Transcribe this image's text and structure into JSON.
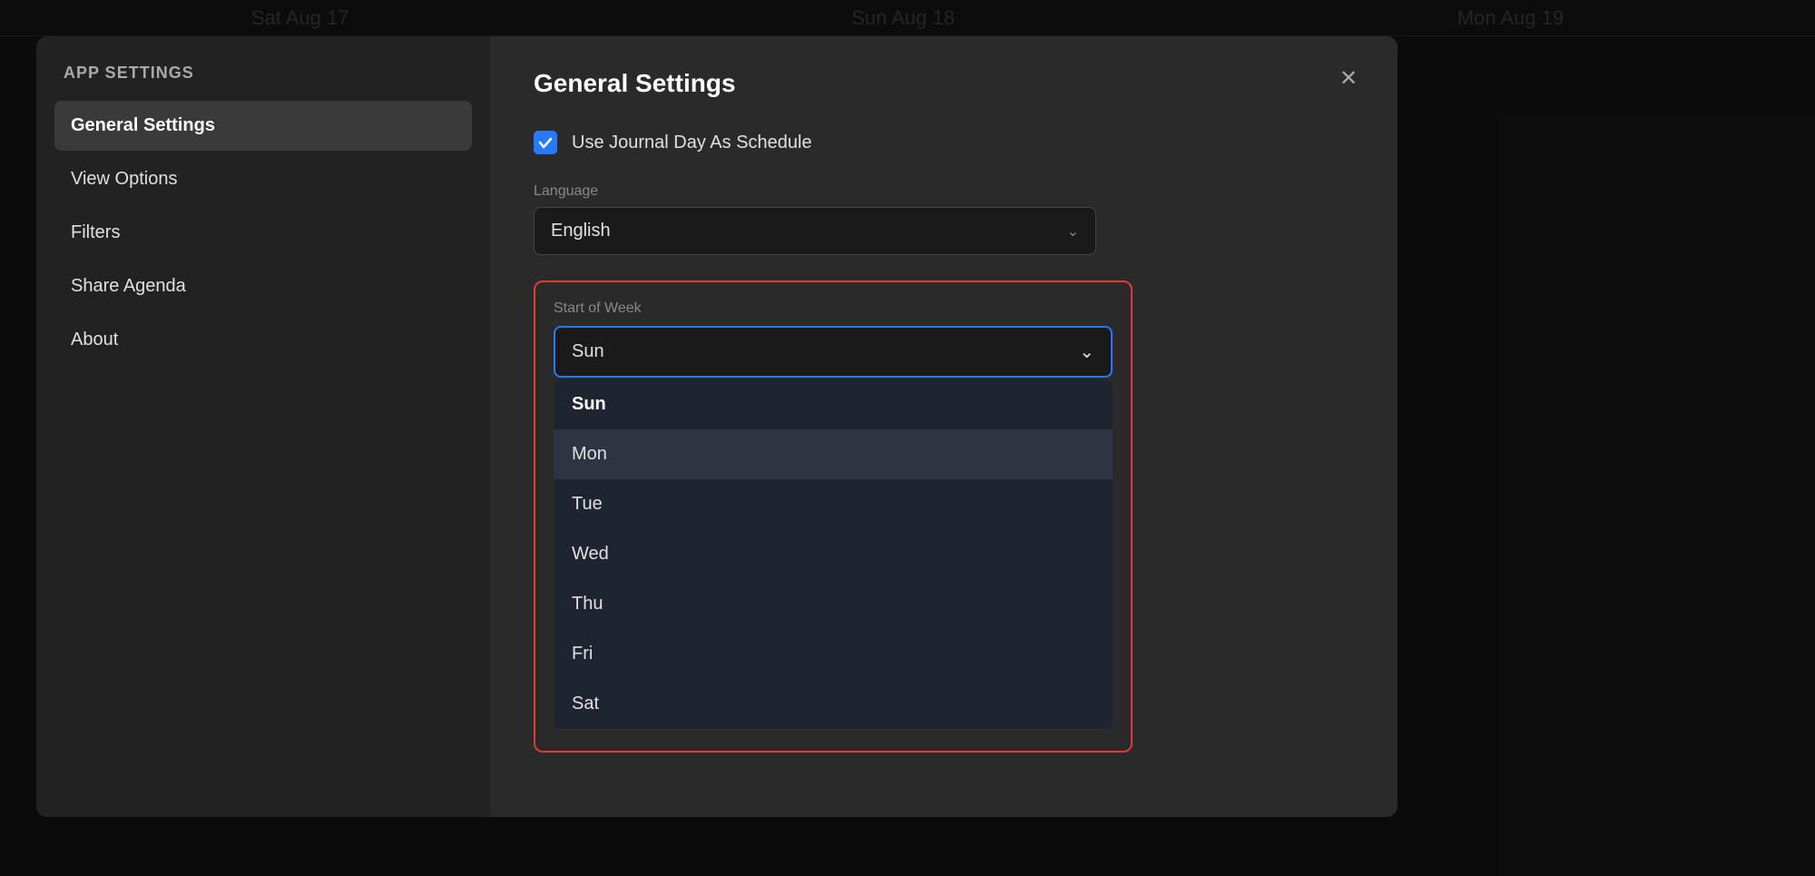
{
  "background": {
    "calendar_days": [
      "Sat Aug 17",
      "Sun Aug 18",
      "Mon Aug 19"
    ]
  },
  "sidebar": {
    "title": "APP SETTINGS",
    "items": [
      {
        "label": "General Settings",
        "active": true
      },
      {
        "label": "View Options",
        "active": false
      },
      {
        "label": "Filters",
        "active": false
      },
      {
        "label": "Share Agenda",
        "active": false
      },
      {
        "label": "About",
        "active": false
      }
    ]
  },
  "modal": {
    "title": "General Settings",
    "close_label": "✕",
    "checkbox": {
      "label": "Use Journal Day As Schedule",
      "checked": true
    },
    "language_field": {
      "label": "Language",
      "value": "English",
      "chevron": "⌄"
    },
    "start_of_week": {
      "label": "Start of Week",
      "selected": "Sun",
      "chevron": "⌄",
      "options": [
        {
          "label": "Sun",
          "selected": true,
          "highlighted": false
        },
        {
          "label": "Mon",
          "selected": false,
          "highlighted": true
        },
        {
          "label": "Tue",
          "selected": false,
          "highlighted": false
        },
        {
          "label": "Wed",
          "selected": false,
          "highlighted": false
        },
        {
          "label": "Thu",
          "selected": false,
          "highlighted": false
        },
        {
          "label": "Fri",
          "selected": false,
          "highlighted": false
        },
        {
          "label": "Sat",
          "selected": false,
          "highlighted": false
        }
      ]
    }
  }
}
